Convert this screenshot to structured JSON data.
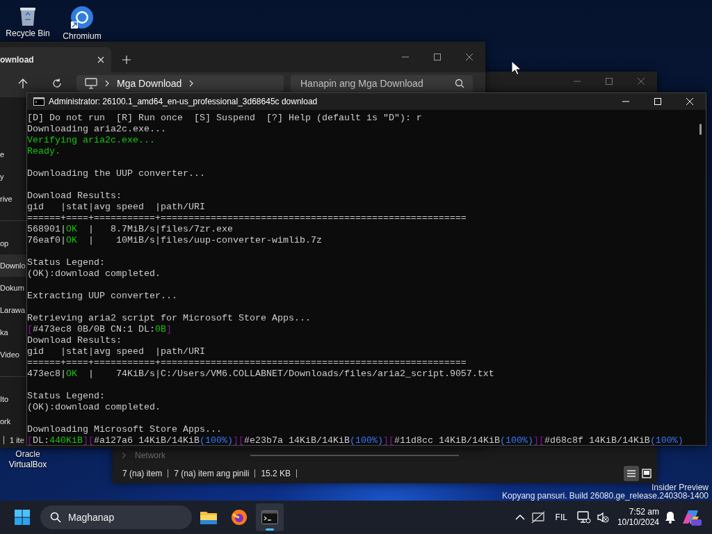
{
  "desktop_icons": [
    {
      "label": "Recycle Bin",
      "kind": "recycle-bin"
    },
    {
      "label": "Chromium",
      "kind": "chromium"
    },
    {
      "label": "Oracle VirtualBox",
      "kind": "virtualbox"
    }
  ],
  "explorer_back": {
    "tab": "ownload",
    "address": "Mga Download",
    "search": {
      "placeholder": "Hanapin ang Mga Download"
    },
    "sidebar": [
      {
        "items": [
          {
            "label": "e",
            "selected": false
          },
          {
            "label": "y",
            "selected": false
          },
          {
            "label": "rive",
            "selected": false
          }
        ]
      },
      {
        "items": [
          {
            "label": "op",
            "selected": false
          },
          {
            "label": "Downlo",
            "selected": true
          },
          {
            "label": "Dokum",
            "selected": false
          },
          {
            "label": "Larawa",
            "selected": false
          },
          {
            "label": "ka",
            "selected": false
          },
          {
            "label": "Video",
            "selected": false
          }
        ]
      },
      {
        "items": [
          {
            "label": "Ito",
            "selected": false
          },
          {
            "label": "ork",
            "selected": false
          }
        ]
      }
    ],
    "status": "1 ite"
  },
  "explorer_front": {
    "nav_item": "Network",
    "status": [
      "7 (na) item",
      "7 (na) item ang pinili",
      "15.2 KB"
    ],
    "view_buttons": [
      {
        "kind": "details",
        "selected": true
      },
      {
        "kind": "tiles",
        "selected": false
      }
    ]
  },
  "console": {
    "title": "Administrator:  26100.1_amd64_en-us_professional_3d68645c download",
    "blocks": [
      [
        {
          "text": "[D] Do not run  [R] Run once  [S] Suspend  [?] Help (default is \"D\"): r"
        },
        {
          "text": "Downloading aria2c.exe..."
        },
        {
          "segments": [
            {
              "text": "Verifying aria2c.exe...",
              "color": "#16c60c"
            }
          ]
        },
        {
          "segments": [
            {
              "text": "Ready.",
              "color": "#16c60c"
            }
          ]
        }
      ],
      [
        {
          "text": "Downloading the UUP converter..."
        }
      ],
      [
        {
          "text": "Download Results:"
        },
        {
          "text": "gid   |stat|avg speed  |path/URI"
        },
        {
          "text": "======+====+===========+======================================================="
        },
        {
          "segments": [
            {
              "text": "568901|",
              "color": "#cccccc"
            },
            {
              "text": "OK",
              "color": "#16c60c"
            },
            {
              "text": "  |   8.7MiB/s|files/7zr.exe",
              "color": "#cccccc"
            }
          ]
        },
        {
          "segments": [
            {
              "text": "76eaf0|",
              "color": "#cccccc"
            },
            {
              "text": "OK",
              "color": "#16c60c"
            },
            {
              "text": "  |    10MiB/s|files/uup-converter-wimlib.7z",
              "color": "#cccccc"
            }
          ]
        }
      ],
      [
        {
          "text": "Status Legend:"
        },
        {
          "text": "(OK):download completed."
        }
      ],
      [
        {
          "text": "Extracting UUP converter..."
        }
      ],
      [
        {
          "text": "Retrieving aria2 script for Microsoft Store Apps..."
        },
        {
          "segments": [
            {
              "text": "[",
              "color": "#881798"
            },
            {
              "text": "#473ec8 0B/0B CN:1 DL:",
              "color": "#cccccc"
            },
            {
              "text": "0B",
              "color": "#16c60c"
            },
            {
              "text": "]",
              "color": "#881798"
            }
          ]
        },
        {
          "text": "Download Results:"
        },
        {
          "text": "gid   |stat|avg speed  |path/URI"
        },
        {
          "text": "======+====+===========+======================================================="
        },
        {
          "segments": [
            {
              "text": "473ec8|",
              "color": "#cccccc"
            },
            {
              "text": "OK",
              "color": "#16c60c"
            },
            {
              "text": "  |    74KiB/s|C:/Users/VM6.COLLABNET/Downloads/files/aria2_script.9057.txt",
              "color": "#cccccc"
            }
          ]
        }
      ],
      [
        {
          "text": "Status Legend:"
        },
        {
          "text": "(OK):download completed."
        }
      ],
      [
        {
          "text": "Downloading Microsoft Store Apps..."
        },
        {
          "segments": [
            {
              "text": "[",
              "color": "#881798"
            },
            {
              "text": "DL:",
              "color": "#cccccc"
            },
            {
              "text": "440KiB",
              "color": "#16c60c"
            },
            {
              "text": "][",
              "color": "#881798"
            },
            {
              "text": "#a127a6 14KiB/14KiB",
              "color": "#cccccc"
            },
            {
              "text": "(100%)",
              "color": "#3b78ff"
            },
            {
              "text": "][",
              "color": "#881798"
            },
            {
              "text": "#e23b7a 14KiB/14KiB",
              "color": "#cccccc"
            },
            {
              "text": "(100%)",
              "color": "#3b78ff"
            },
            {
              "text": "][",
              "color": "#881798"
            },
            {
              "text": "#11d8cc 14KiB/14KiB",
              "color": "#cccccc"
            },
            {
              "text": "(100%)",
              "color": "#3b78ff"
            },
            {
              "text": "][",
              "color": "#881798"
            },
            {
              "text": "#d68c8f 14KiB/14KiB",
              "color": "#cccccc"
            },
            {
              "text": "(100%)",
              "color": "#3b78ff"
            }
          ]
        }
      ]
    ]
  },
  "os_notice": [
    "Insider Preview",
    "Kopyang pansuri. Build 26080.ge_release.240308-1400"
  ],
  "taskbar": {
    "search": {
      "placeholder": "Maghanap"
    },
    "apps": [
      {
        "kind": "file-explorer",
        "selected": false
      },
      {
        "kind": "firefox",
        "selected": false
      },
      {
        "kind": "terminal",
        "selected": true
      }
    ],
    "language": "FIL",
    "time": "7:52 am",
    "date": "10/10/2024"
  }
}
